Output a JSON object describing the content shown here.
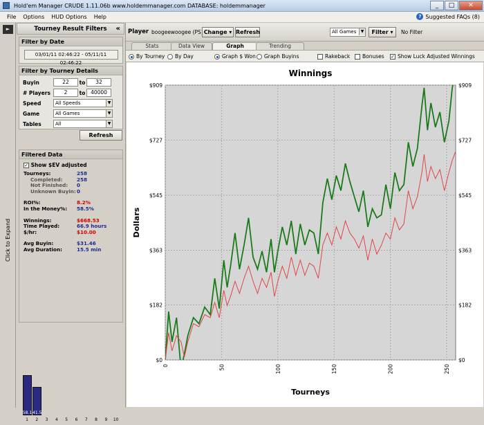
{
  "window": {
    "title": "Hold'em Manager CRUDE 1.11.06b        www.holdemmanager.com        DATABASE: holdemmanager",
    "buttons": [
      "_",
      "□",
      "✕"
    ]
  },
  "menu": {
    "items": [
      "File",
      "Options",
      "HUD Options",
      "Help"
    ],
    "faq": "Suggested FAQs (8)"
  },
  "side_strip": {
    "expand_arrow": "►",
    "label": "Click to Expand"
  },
  "filters": {
    "title": "Tourney Result Filters",
    "collapse": "«",
    "date_group": {
      "title": "Filter by Date",
      "range": "03/01/11 02:46:22 - 05/11/11 02:46:22"
    },
    "details_group": {
      "title": "Filter by Tourney Details",
      "buyin_label": "Buyin",
      "buyin_from": "22",
      "buyin_to": "32",
      "players_label": "# Players",
      "players_from": "2",
      "players_to": "40000",
      "to": "to",
      "speed_label": "Speed",
      "speed_value": "All Speeds",
      "game_label": "Game",
      "game_value": "All Games",
      "tables_label": "Tables",
      "tables_value": "All"
    },
    "refresh": "Refresh"
  },
  "filtered": {
    "title": "Filtered Data",
    "sev_label": "Show $EV adjusted",
    "sev_check": "✓",
    "stats": [
      {
        "k": "Tourneys:",
        "v": "258"
      },
      {
        "k": "Completed:",
        "v": "258"
      },
      {
        "k": "Not Finished:",
        "v": "0"
      },
      {
        "k": "Unknown Buyin:",
        "v": "0"
      },
      {
        "k": "ROI%:",
        "v": "8.2%"
      },
      {
        "k": "In the Money%:",
        "v": "58.5%"
      },
      {
        "k": "Winnings:",
        "v": "$668.53"
      },
      {
        "k": "Time Played:",
        "v": "66.9  hours"
      },
      {
        "k": "$/hr:",
        "v": "$10.00"
      },
      {
        "k": "Avg Buyin:",
        "v": "$31.46"
      },
      {
        "k": "Avg Duration:",
        "v": "15.5  min"
      }
    ],
    "histogram": {
      "bar_labels": [
        "58.1",
        "41.5"
      ],
      "values": [
        58.1,
        41.5
      ],
      "x": [
        "1",
        "2",
        "3",
        "4",
        "5",
        "6",
        "7",
        "8",
        "9",
        "10"
      ]
    }
  },
  "player": {
    "label": "Player",
    "name": "boogeewoogee (PS)",
    "change": "Change",
    "refresh": "Refresh",
    "games": "All Games",
    "filter": "Filter",
    "no_filter": "No Filter"
  },
  "tabs": [
    "Stats",
    "Data View",
    "Graph",
    "Trending"
  ],
  "options": {
    "by_tourney": "By Tourney",
    "by_day": "By Day",
    "graph_won": "Graph $ Won",
    "graph_buyins": "Graph Buyins",
    "rakeback": "Rakeback",
    "bonuses": "Bonuses",
    "luck": "Show Luck Adjusted Winnings",
    "check": "✓"
  },
  "chart_data": {
    "type": "line",
    "title": "Winnings",
    "xlabel": "Tourneys",
    "ylabel": "Dollars",
    "xlim": [
      0,
      258
    ],
    "ylim": [
      0,
      909
    ],
    "x_ticks": [
      0,
      50,
      100,
      150,
      200,
      250
    ],
    "y_ticks": [
      "$0",
      "$182",
      "$363",
      "$545",
      "$727",
      "$909"
    ],
    "y_tick_values": [
      0,
      182,
      363,
      545,
      727,
      909
    ],
    "grid": true,
    "series": [
      {
        "color": "#1a7a1a",
        "x": [
          0,
          3,
          6,
          10,
          14,
          17,
          20,
          25,
          30,
          35,
          40,
          44,
          48,
          52,
          55,
          58,
          62,
          66,
          70,
          74,
          78,
          82,
          86,
          90,
          94,
          97,
          100,
          104,
          108,
          112,
          116,
          120,
          124,
          128,
          132,
          136,
          140,
          144,
          148,
          152,
          156,
          160,
          164,
          168,
          172,
          176,
          180,
          184,
          188,
          192,
          196,
          200,
          204,
          208,
          212,
          216,
          220,
          224,
          228,
          230,
          233,
          236,
          240,
          244,
          248,
          252,
          255,
          258
        ],
        "y": [
          0,
          160,
          60,
          140,
          -30,
          20,
          80,
          140,
          120,
          175,
          150,
          270,
          170,
          330,
          240,
          310,
          420,
          300,
          380,
          470,
          340,
          300,
          360,
          290,
          400,
          290,
          360,
          440,
          380,
          460,
          350,
          450,
          380,
          430,
          420,
          350,
          520,
          600,
          530,
          610,
          560,
          650,
          590,
          540,
          490,
          560,
          440,
          500,
          470,
          480,
          580,
          500,
          620,
          560,
          580,
          720,
          640,
          700,
          840,
          900,
          760,
          850,
          770,
          820,
          720,
          790,
          900,
          950
        ]
      },
      {
        "color": "#e04545",
        "x": [
          0,
          3,
          6,
          10,
          14,
          17,
          20,
          25,
          30,
          35,
          40,
          44,
          48,
          52,
          55,
          58,
          62,
          66,
          70,
          74,
          78,
          82,
          86,
          90,
          94,
          97,
          100,
          104,
          108,
          112,
          116,
          120,
          124,
          128,
          132,
          136,
          140,
          144,
          148,
          152,
          156,
          160,
          164,
          168,
          172,
          176,
          180,
          184,
          188,
          192,
          196,
          200,
          204,
          208,
          212,
          216,
          220,
          224,
          228,
          230,
          233,
          236,
          240,
          244,
          248,
          252,
          255,
          258
        ],
        "y": [
          0,
          90,
          30,
          80,
          60,
          10,
          60,
          120,
          110,
          150,
          140,
          190,
          140,
          230,
          180,
          210,
          260,
          220,
          270,
          310,
          260,
          220,
          270,
          240,
          290,
          210,
          260,
          310,
          270,
          340,
          280,
          330,
          280,
          320,
          310,
          270,
          380,
          420,
          380,
          440,
          400,
          460,
          420,
          400,
          370,
          410,
          330,
          400,
          350,
          380,
          420,
          400,
          470,
          430,
          450,
          560,
          500,
          540,
          620,
          680,
          590,
          640,
          600,
          630,
          560,
          620,
          660,
          690
        ]
      }
    ]
  }
}
